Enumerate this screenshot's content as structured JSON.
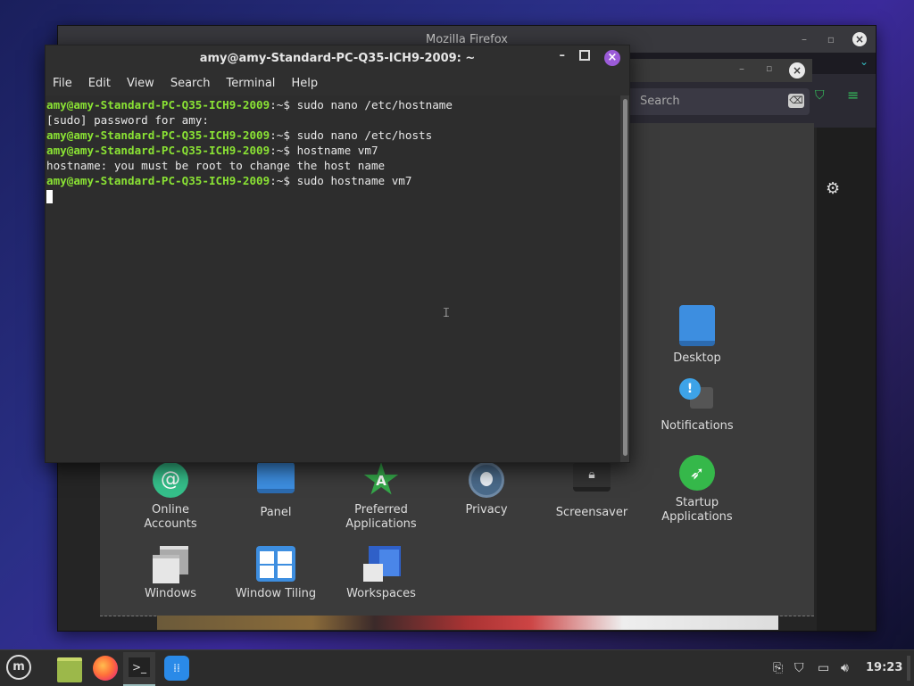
{
  "firefox": {
    "title": "Mozilla Firefox",
    "search_placeholder": "Search"
  },
  "terminal": {
    "title": "amy@amy-Standard-PC-Q35-ICH9-2009: ~",
    "menu": [
      "File",
      "Edit",
      "View",
      "Search",
      "Terminal",
      "Help"
    ],
    "lines": [
      {
        "prompt": "amy@amy-Standard-PC-Q35-ICH9-2009",
        "path": ":~$ ",
        "cmd": "sudo nano /etc/hostname"
      },
      {
        "prompt": "",
        "path": "",
        "cmd": "[sudo] password for amy:"
      },
      {
        "prompt": "amy@amy-Standard-PC-Q35-ICH9-2009",
        "path": ":~$ ",
        "cmd": "sudo nano /etc/hosts"
      },
      {
        "prompt": "amy@amy-Standard-PC-Q35-ICH9-2009",
        "path": ":~$ ",
        "cmd": "hostname vm7"
      },
      {
        "prompt": "",
        "path": "",
        "cmd": "hostname: you must be root to change the host name"
      },
      {
        "prompt": "amy@amy-Standard-PC-Q35-ICH9-2009",
        "path": ":~$ ",
        "cmd": "sudo hostname vm7"
      }
    ]
  },
  "settings": {
    "tiles": [
      {
        "label": "Desktop",
        "icon": "desktop-icon"
      },
      {
        "label": "Notifications",
        "icon": "notifications-icon"
      },
      {
        "label": "Online\nAccounts",
        "icon": "online-accounts-icon"
      },
      {
        "label": "Panel",
        "icon": "panel-icon"
      },
      {
        "label": "Preferred\nApplications",
        "icon": "preferred-apps-icon"
      },
      {
        "label": "Privacy",
        "icon": "privacy-icon"
      },
      {
        "label": "Screensaver",
        "icon": "screensaver-icon"
      },
      {
        "label": "Startup\nApplications",
        "icon": "startup-apps-icon"
      },
      {
        "label": "Windows",
        "icon": "windows-icon"
      },
      {
        "label": "Window Tiling",
        "icon": "window-tiling-icon"
      },
      {
        "label": "Workspaces",
        "icon": "workspaces-icon"
      }
    ]
  },
  "taskbar": {
    "clock": "19:23"
  },
  "colors": {
    "prompt": "#8ae234",
    "accent": "#35bf5c",
    "close": "#9b5bd8"
  }
}
